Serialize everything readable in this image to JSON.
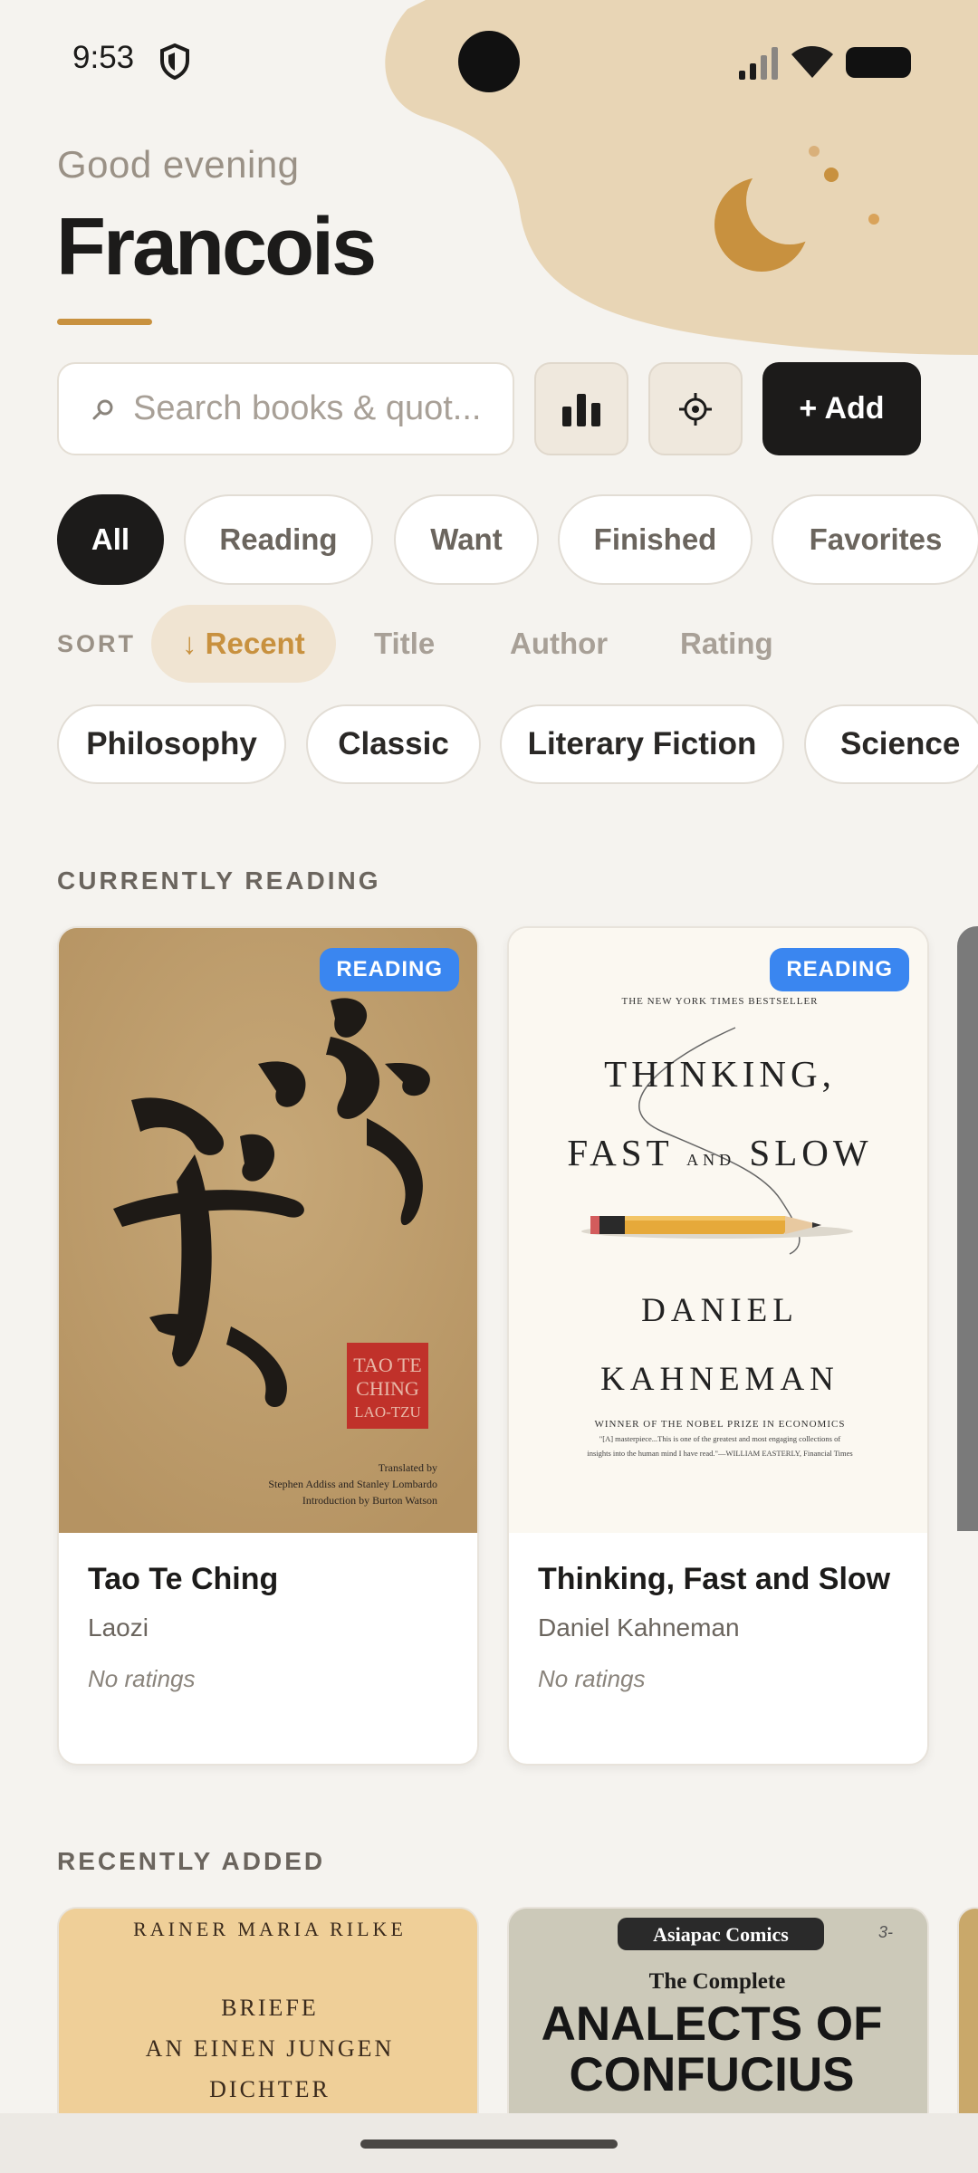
{
  "status": {
    "time": "9:53"
  },
  "header": {
    "greeting": "Good evening",
    "name": "Francois"
  },
  "search": {
    "placeholder": "Search books & quot..."
  },
  "toolbar": {
    "add_label": "+ Add"
  },
  "filters": [
    "All",
    "Reading",
    "Want",
    "Finished",
    "Favorites"
  ],
  "sort": {
    "label": "SORT",
    "options": [
      "↓ Recent",
      "Title",
      "Author",
      "Rating"
    ]
  },
  "tags": [
    "Philosophy",
    "Classic",
    "Literary Fiction",
    "Science"
  ],
  "currently_reading": {
    "title": "CURRENTLY READING",
    "books": [
      {
        "badge": "READING",
        "title": "Tao Te Ching",
        "author": "Laozi",
        "rating": "No ratings",
        "cover": {
          "seal": [
            "TAO TE",
            "CHING",
            "LAO-TZU"
          ],
          "credits": [
            "Translated by",
            "Stephen Addiss and Stanley Lombardo",
            "Introduction by Burton Watson"
          ]
        }
      },
      {
        "badge": "READING",
        "title": "Thinking, Fast and Slow",
        "author": "Daniel Kahneman",
        "rating": "No ratings",
        "cover": {
          "top": "THE NEW YORK TIMES BESTSELLER",
          "line1": "THINKING,",
          "line2a": "FAST ",
          "line2b": "AND",
          "line2c": " SLOW",
          "author1": "DANIEL",
          "author2": "KAHNEMAN",
          "prize": "WINNER OF THE NOBEL PRIZE IN ECONOMICS",
          "quote1": "\"[A] masterpiece...This is one of the greatest and most engaging collections of",
          "quote2": "insights into the human mind I have read.\"—WILLIAM EASTERLY, Financial Times"
        }
      }
    ]
  },
  "recently_added": {
    "title": "RECENTLY ADDED",
    "books": [
      {
        "cover": {
          "author": "RAINER MARIA RILKE",
          "l1": "BRIEFE",
          "l2": "AN EINEN JUNGEN",
          "l3": "DICHTER"
        }
      },
      {
        "cover": {
          "publisher": "Asiapac Comics",
          "sub": "The Complete",
          "l1": "ANALECTS OF",
          "l2": "CONFUCIUS",
          "mark": "3-"
        }
      }
    ]
  },
  "colors": {
    "accent": "#c8913f",
    "badge": "#3a86f0",
    "background": "#f5f3ef",
    "blob": "#e8d5b5"
  }
}
